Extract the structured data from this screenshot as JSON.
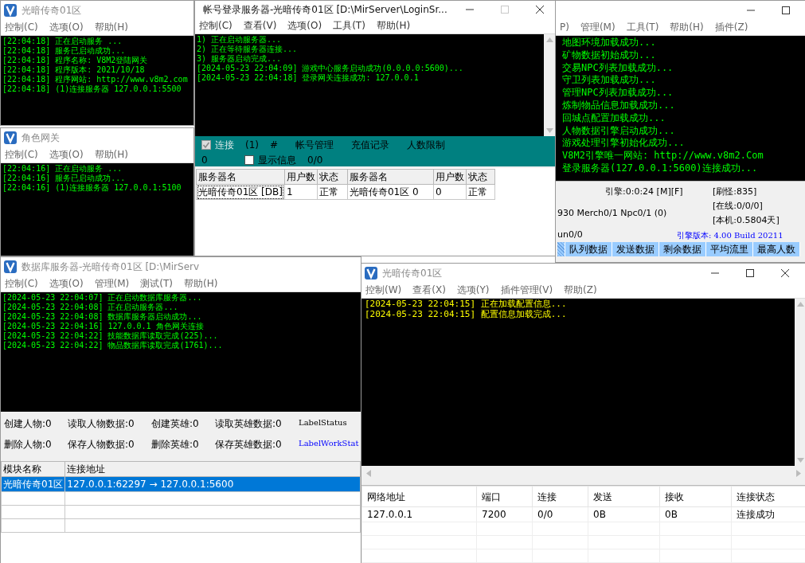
{
  "gate_window": {
    "title": "光暗传奇01区",
    "active": false,
    "menu": [
      "控制(C)",
      "选项(O)",
      "帮助(H)"
    ],
    "console": [
      "[22:04:18] 正在启动服务 ...",
      "[22:04:18] 服务已启动成功...",
      "[22:04:18] 程序名称: V8M2登陆网关",
      "[22:04:18] 程序版本: 2021/10/18",
      "[22:04:18] 程序网站: http://www.v8m2.com",
      "[22:04:18] (1)连接服务器 127.0.0.1:5500"
    ]
  },
  "role_gate_window": {
    "title": "角色网关",
    "active": false,
    "menu": [
      "控制(C)",
      "选项(O)",
      "帮助(H)"
    ],
    "console": [
      "[22:04:16] 正在启动服务 ...",
      "[22:04:16] 服务已启动成功...",
      "[22:04:16] (1)连接服务器 127.0.0.1:5100"
    ]
  },
  "engine_window": {
    "active": false,
    "controls": [
      {
        "kind": "minimize",
        "disabled": false
      },
      {
        "kind": "maximize",
        "disabled": false
      }
    ],
    "menu": [
      "P)",
      "管理(M)",
      "工具(T)",
      "帮助(H)",
      "插件(Z)"
    ],
    "console": [
      "地图环境加载成功...",
      "矿物数据初始成功...",
      "交易NPC列表加载成功...",
      "守卫列表加载成功...",
      "管理NPC列表加载成功...",
      "炼制物品信息加载成功...",
      "回城点配置加载成功...",
      "人物数据引擎启动成功...",
      "游戏处理引擎初始化成功...",
      "V8M2引擎唯一网站: http://www.v8m2.Com",
      "登录服务器(127.0.0.1:5600)连接成功..."
    ],
    "status": {
      "engine_time": "引擎:0:0:24 [M][F]",
      "monsters": "[刷怪:835]",
      "online": "[在线:0/0/0]",
      "counts": "930 Merch0/1 Npc0/1 (0)",
      "uptime": "[本机:0.5804天]",
      "run": "un0/0",
      "version": "引擎版本: 4.00 Build 20211"
    },
    "columns": [
      "队列数据",
      "发送数据",
      "剩余数据",
      "平均流里",
      "最高人数"
    ]
  },
  "login_window": {
    "title": "帐号登录服务器-光暗传奇01区  [D:\\MirServer\\LoginSr...",
    "active": true,
    "controls": [
      {
        "kind": "minimize",
        "disabled": false
      },
      {
        "kind": "maximize",
        "disabled": true
      },
      {
        "kind": "close",
        "disabled": false
      }
    ],
    "menu": [
      "控制(C)",
      "查看(V)",
      "选项(O)",
      "工具(T)",
      "帮助(H)"
    ],
    "console": [
      "1) 正在启动服务器...",
      "2) 正在等待服务器连接...",
      "3) 服务器启动完成...",
      "[2024-05-23 22:04:09] 游戏中心服务启动成功(0.0.0.0:5600)...",
      "[2024-05-23 22:04:18] 登录网关连接成功: 127.0.0.1"
    ],
    "toolbar": {
      "connect": {
        "label": "连接",
        "checked": true,
        "disabled": true
      },
      "connect_count": "(1)",
      "hash": "#",
      "links": [
        "帐号管理",
        "充值记录",
        "人数限制"
      ],
      "count": "0",
      "show_info": {
        "label": "显示信息",
        "checked": false,
        "disabled": false
      },
      "info_count": "0/0"
    },
    "table": {
      "columns": [
        "服务器名",
        "用户数",
        "状态",
        "服务器名",
        "用户数",
        "状态"
      ],
      "rows": [
        {
          "cells": [
            "光暗传奇01区 [DB]",
            "1",
            "正常",
            "光暗传奇01区 0",
            "0",
            "正常"
          ],
          "focused": true
        }
      ]
    }
  },
  "db_window": {
    "title": "数据库服务器-光暗传奇01区  [D:\\MirServ",
    "active": false,
    "menu": [
      "控制(C)",
      "选项(O)",
      "管理(M)",
      "测试(T)",
      "帮助(H)"
    ],
    "console": [
      "[2024-05-23 22:04:07] 正在启动数据库服务器...",
      "[2024-05-23 22:04:08] 正在启动服务器...",
      "[2024-05-23 22:04:08] 数据库服务器启动成功...",
      "[2024-05-23 22:04:16] 127.0.0.1 角色网关连接",
      "[2024-05-23 22:04:22] 技能数据库读取完成(225)...",
      "[2024-05-23 22:04:22] 物品数据库读取完成(1761)..."
    ],
    "stats": [
      [
        {
          "text": "创建人物:0",
          "kind": "value"
        },
        {
          "text": "读取人物数据:0",
          "kind": "value"
        },
        {
          "text": "创建英雄:0",
          "kind": "value"
        },
        {
          "text": "读取英雄数据:0",
          "kind": "value"
        },
        {
          "text": "LabelStatus",
          "kind": "status"
        }
      ],
      [
        {
          "text": "删除人物:0",
          "kind": "value"
        },
        {
          "text": "保存人物数据:0",
          "kind": "value"
        },
        {
          "text": "删除英雄:0",
          "kind": "value"
        },
        {
          "text": "保存英雄数据:0",
          "kind": "value"
        },
        {
          "text": "LabelWorkStat",
          "kind": "work"
        }
      ]
    ],
    "table": {
      "columns": [
        "模块名称",
        "连接地址"
      ],
      "rows": [
        {
          "cells": [
            "光暗传奇01区",
            "127.0.0.1:62297 → 127.0.0.1:5600"
          ],
          "selected": true
        }
      ]
    }
  },
  "run_gate_window": {
    "title": "光暗传奇01区",
    "active": false,
    "controls": [
      {
        "kind": "minimize",
        "disabled": false
      },
      {
        "kind": "maximize",
        "disabled": false
      },
      {
        "kind": "close",
        "disabled": false
      }
    ],
    "menu": [
      "控制(W)",
      "查看(X)",
      "选项(Y)",
      "插件管理(V)",
      "帮助(Z)"
    ],
    "console": [
      "[2024-05-23 22:04:15] 正在加载配置信息...",
      "[2024-05-23 22:04:15] 配置信息加载完成..."
    ],
    "table": {
      "columns": [
        "网络地址",
        "端口",
        "连接",
        "发送",
        "接收",
        "连接状态"
      ],
      "rows": [
        {
          "cells": [
            "127.0.0.1",
            "7200",
            "0/0",
            "0B",
            "0B",
            "连接成功"
          ]
        }
      ]
    }
  }
}
